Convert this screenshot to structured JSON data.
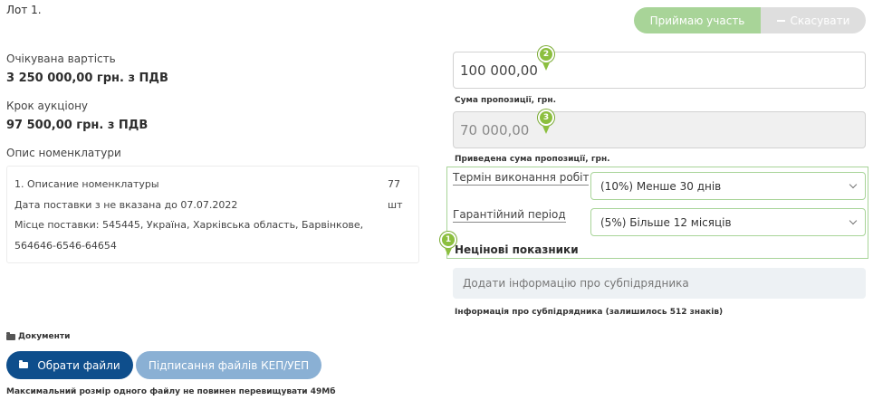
{
  "lot": {
    "title": "Лот 1."
  },
  "actions": {
    "participate_label": "Приймаю участь",
    "cancel_label": "Скасувати"
  },
  "expected_value": {
    "label": "Очікувана вартість",
    "value": "3 250 000,00 грн. з ПДВ"
  },
  "auction_step": {
    "label": "Крок аукціону",
    "value": "97 500,00 грн. з ПДВ"
  },
  "nomenclature": {
    "label": "Опис номенклатури",
    "item_name": "1. Описание номенклатуры",
    "quantity": "77",
    "unit": "шт",
    "delivery_date": "Дата поставки з не вказана до 07.07.2022",
    "delivery_place_line1": "Місце поставки: 545445, Україна, Харківська область, Барвінкове,",
    "delivery_place_line2": "564646-6546-64654"
  },
  "offer": {
    "amount_value": "100 000,00",
    "amount_label": "Сума пропозиції, грн.",
    "reduced_value": "70 000,00",
    "reduced_label": "Приведена сума пропозиції, грн."
  },
  "markers": {
    "m1": "1",
    "m2": "2",
    "m3": "3"
  },
  "criteria": {
    "term_label": "Термін виконання робіт",
    "term_selected": "(10%) Менше 30 днів",
    "warranty_label": "Гарантійний період",
    "warranty_selected": "(5%) Більше 12 місяців",
    "section_title": "Нецінові показники"
  },
  "subcontractor": {
    "placeholder": "Додати інформацію про субпідрядника",
    "hint": "Інформація про субпідрядника (залишилось 512 знаків)"
  },
  "documents": {
    "title": "Документи",
    "choose_label": "Обрати файли",
    "sign_label": "Підписання файлів КЕП/УЕП",
    "max_size_note": "Максимальний розмір одного файлу не повинен перевищувати 49Мб"
  },
  "colors": {
    "accent_green": "#a8d498",
    "marker_green": "#8cbf3f",
    "primary_blue": "#0e4e8c",
    "secondary_blue": "#8ab0d4"
  }
}
